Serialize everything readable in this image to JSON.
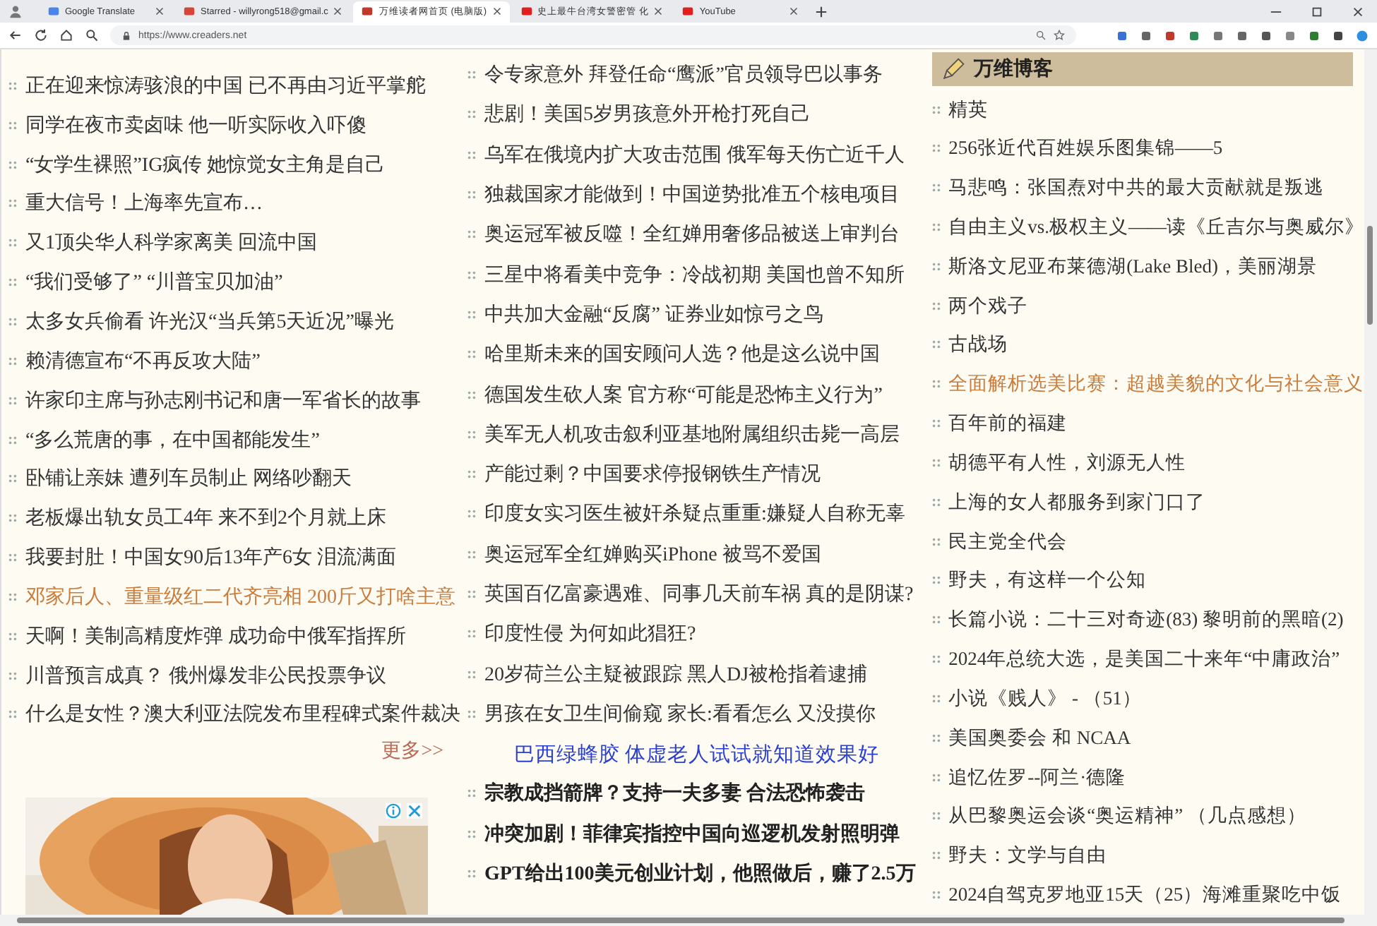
{
  "browser": {
    "tabs": [
      {
        "title": "Google Translate",
        "selected": false
      },
      {
        "title": "Starred - willyrong518@gmail.c",
        "selected": false
      },
      {
        "title": "万维读者网首页 (电脑版)",
        "selected": true
      },
      {
        "title": "史上最牛台湾女警密管 化",
        "selected": false
      },
      {
        "title": "YouTube",
        "selected": false
      }
    ],
    "address": "https://www.creaders.net"
  },
  "left_column": {
    "items": [
      {
        "text": "正在迎来惊涛骇浪的中国 已不再由习近平掌舵",
        "highlighted": false
      },
      {
        "text": "同学在夜市卖卤味 他一听实际收入吓傻",
        "highlighted": false
      },
      {
        "text": "“女学生裸照”IG疯传 她惊觉女主角是自己",
        "highlighted": false
      },
      {
        "text": "重大信号！上海率先宣布…",
        "highlighted": false
      },
      {
        "text": "又1顶尖华人科学家离美 回流中国",
        "highlighted": false
      },
      {
        "text": "“我们受够了” “川普宝贝加油”",
        "highlighted": false
      },
      {
        "text": "太多女兵偷看 许光汉“当兵第5天近况”曝光",
        "highlighted": false
      },
      {
        "text": "赖清德宣布“不再反攻大陆”",
        "highlighted": false
      },
      {
        "text": "许家印主席与孙志刚书记和唐一军省长的故事",
        "highlighted": false
      },
      {
        "text": "“多么荒唐的事，在中国都能发生”",
        "highlighted": false
      },
      {
        "text": "卧铺让亲妹 遭列车员制止 网络吵翻天",
        "highlighted": false
      },
      {
        "text": "老板爆出轨女员工4年 来不到2个月就上床",
        "highlighted": false
      },
      {
        "text": "我要封肚！中国女90后13年产6女 泪流满面",
        "highlighted": false
      },
      {
        "text": "邓家后人、重量级红二代齐亮相 200斤又打啥主意",
        "highlighted": true
      },
      {
        "text": "天啊！美制高精度炸弹 成功命中俄军指挥所",
        "highlighted": false
      },
      {
        "text": "川普预言成真？ 俄州爆发非公民投票争议",
        "highlighted": false
      },
      {
        "text": "什么是女性？澳大利亚法院发布里程碑式案件裁决",
        "highlighted": false
      }
    ],
    "more_link": "更多>>"
  },
  "middle_column": {
    "items": [
      {
        "kind": "headline",
        "text": "令专家意外 拜登任命“鹰派”官员领导巴以事务",
        "highlighted": false
      },
      {
        "kind": "headline",
        "text": "悲剧！美国5岁男孩意外开枪打死自己",
        "highlighted": false
      },
      {
        "kind": "headline",
        "text": "乌军在俄境内扩大攻击范围 俄军每天伤亡近千人",
        "highlighted": false
      },
      {
        "kind": "headline",
        "text": "独裁国家才能做到！中国逆势批准五个核电项目",
        "highlighted": false
      },
      {
        "kind": "headline",
        "text": "奥运冠军被反噬！全红婵用奢侈品被送上审判台",
        "highlighted": false
      },
      {
        "kind": "headline",
        "text": "三星中将看美中竞争：冷战初期 美国也曾不知所",
        "highlighted": false
      },
      {
        "kind": "headline",
        "text": "中共加大金融“反腐” 证券业如惊弓之鸟",
        "highlighted": false
      },
      {
        "kind": "headline",
        "text": "哈里斯未来的国安顾问人选？他是这么说中国",
        "highlighted": false
      },
      {
        "kind": "headline",
        "text": "德国发生砍人案 官方称“可能是恐怖主义行为”",
        "highlighted": false
      },
      {
        "kind": "headline",
        "text": "美军无人机攻击叙利亚基地附属组织击毙一高层",
        "highlighted": false
      },
      {
        "kind": "headline",
        "text": "产能过剩？中国要求停报钢铁生产情况",
        "highlighted": false
      },
      {
        "kind": "headline",
        "text": "印度女实习医生被奸杀疑点重重:嫌疑人自称无辜",
        "highlighted": false
      },
      {
        "kind": "headline",
        "text": "奥运冠军全红婵购买iPhone 被骂不爱国",
        "highlighted": false
      },
      {
        "kind": "headline",
        "text": "英国百亿富豪遇难、同事几天前车祸 真的是阴谋?",
        "highlighted": false
      },
      {
        "kind": "headline",
        "text": "印度性侵 为何如此猖狂?",
        "highlighted": false
      },
      {
        "kind": "headline",
        "text": "20岁荷兰公主疑被跟踪 黑人DJ被枪指着逮捕",
        "highlighted": false
      },
      {
        "kind": "headline",
        "text": "男孩在女卫生间偷窥 家长:看看怎么 又没摸你",
        "highlighted": false
      },
      {
        "kind": "ad",
        "text": "巴西绿蜂胶 体虚老人试试就知道效果好",
        "highlighted": false
      },
      {
        "kind": "bold",
        "text": "宗教成挡箭牌？支持一夫多妻 合法恐怖袭击"
      },
      {
        "kind": "bold",
        "text": "冲突加剧！菲律宾指控中国向巡逻机发射照明弹"
      },
      {
        "kind": "bold",
        "text": "GPT给出100美元创业计划，他照做后，赚了2.5万"
      }
    ]
  },
  "blog": {
    "title": "万维博客",
    "items": [
      {
        "text": "精英",
        "highlighted": false
      },
      {
        "text": "256张近代百姓娱乐图集锦——5",
        "highlighted": false
      },
      {
        "text": "马悲鸣：张国焘对中共的最大贡献就是叛逃",
        "highlighted": false
      },
      {
        "text": "自由主义vs.极权主义——读《丘吉尔与奥威尔》",
        "highlighted": false
      },
      {
        "text": "斯洛文尼亚布莱德湖(Lake Bled)，美丽湖景",
        "highlighted": false
      },
      {
        "text": "两个戏子",
        "highlighted": false
      },
      {
        "text": "古战场",
        "highlighted": false
      },
      {
        "text": "全面解析选美比赛：超越美貌的文化与社会意义",
        "highlighted": true
      },
      {
        "text": "百年前的福建",
        "highlighted": false
      },
      {
        "text": "胡德平有人性，刘源无人性",
        "highlighted": false
      },
      {
        "text": "上海的女人都服务到家门口了",
        "highlighted": false
      },
      {
        "text": "民主党全代会",
        "highlighted": false
      },
      {
        "text": "野夫，有这样一个公知",
        "highlighted": false
      },
      {
        "text": "长篇小说：二十三对奇迹(83) 黎明前的黑暗(2)",
        "highlighted": false
      },
      {
        "text": "2024年总统大选，是美国二十来年“中庸政治”",
        "highlighted": false
      },
      {
        "text": "小说《贱人》 - （51）",
        "highlighted": false
      },
      {
        "text": "美国奥委会 和 NCAA",
        "highlighted": false
      },
      {
        "text": "追忆佐罗--阿兰·德隆",
        "highlighted": false
      },
      {
        "text": "从巴黎奥运会谈“奥运精神” （几点感想）",
        "highlighted": false
      },
      {
        "text": "野夫：文学与自由",
        "highlighted": false
      },
      {
        "text": "2024自驾克罗地亚15天（25）海滩重聚吃中饭",
        "highlighted": false
      }
    ]
  }
}
